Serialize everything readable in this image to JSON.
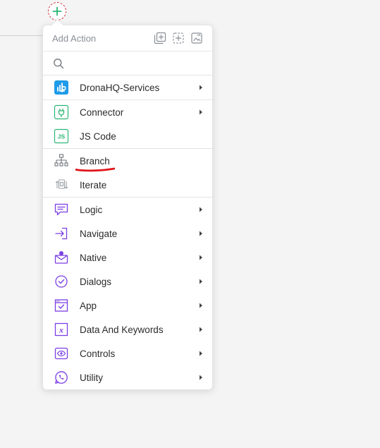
{
  "popup": {
    "title": "Add Action",
    "header_icons": [
      "add-box-icon",
      "select-area-icon",
      "image-swap-icon"
    ],
    "search": {
      "placeholder": "",
      "value": ""
    }
  },
  "groups": [
    {
      "items": [
        {
          "label": "DronaHQ-Services",
          "icon": "dronahq-icon",
          "has_submenu": true
        }
      ]
    },
    {
      "items": [
        {
          "label": "Connector",
          "icon": "plug-icon",
          "has_submenu": true
        },
        {
          "label": "JS Code",
          "icon": "js-icon",
          "has_submenu": false
        }
      ]
    },
    {
      "items": [
        {
          "label": "Branch",
          "icon": "branch-icon",
          "has_submenu": false,
          "annotated": true
        },
        {
          "label": "Iterate",
          "icon": "iterate-icon",
          "has_submenu": false
        }
      ]
    },
    {
      "items": [
        {
          "label": "Logic",
          "icon": "logic-icon",
          "has_submenu": true
        },
        {
          "label": "Navigate",
          "icon": "navigate-icon",
          "has_submenu": true
        },
        {
          "label": "Native",
          "icon": "native-icon",
          "has_submenu": true
        },
        {
          "label": "Dialogs",
          "icon": "dialogs-icon",
          "has_submenu": true
        },
        {
          "label": "App",
          "icon": "app-icon",
          "has_submenu": true
        },
        {
          "label": "Data And Keywords",
          "icon": "data-keywords-icon",
          "has_submenu": true
        },
        {
          "label": "Controls",
          "icon": "controls-icon",
          "has_submenu": true
        },
        {
          "label": "Utility",
          "icon": "utility-icon",
          "has_submenu": true
        }
      ]
    }
  ],
  "colors": {
    "accent_purple": "#7b3fe4",
    "connector_green": "#2bb673",
    "dronahq_blue": "#1e9be9",
    "annotation_red": "#e0151b",
    "add_node_border": "#d0343f"
  }
}
